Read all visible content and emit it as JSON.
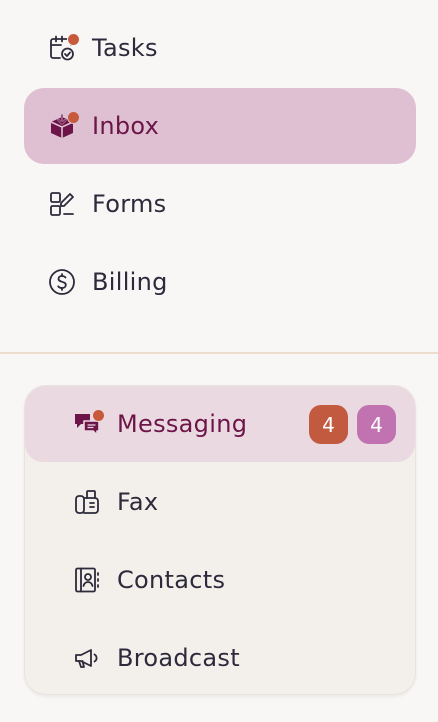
{
  "nav": {
    "items": [
      {
        "label": "Tasks",
        "icon": "calendar-check-icon",
        "notification": true
      },
      {
        "label": "Inbox",
        "icon": "inbox-box-icon",
        "notification": true,
        "active": true
      },
      {
        "label": "Forms",
        "icon": "forms-icon"
      },
      {
        "label": "Billing",
        "icon": "dollar-circle-icon"
      }
    ]
  },
  "messaging_group": {
    "items": [
      {
        "label": "Messaging",
        "icon": "chat-bubbles-icon",
        "notification": true,
        "active": true,
        "badges": [
          {
            "count": "4",
            "color": "#c25a40"
          },
          {
            "count": "4",
            "color": "#c073b0"
          }
        ]
      },
      {
        "label": "Fax",
        "icon": "fax-icon"
      },
      {
        "label": "Contacts",
        "icon": "contacts-book-icon"
      },
      {
        "label": "Broadcast",
        "icon": "megaphone-icon"
      }
    ]
  },
  "colors": {
    "active_bg": "#dfc0d3",
    "active_text": "#6d1448",
    "notification_dot": "#c85a3c"
  }
}
